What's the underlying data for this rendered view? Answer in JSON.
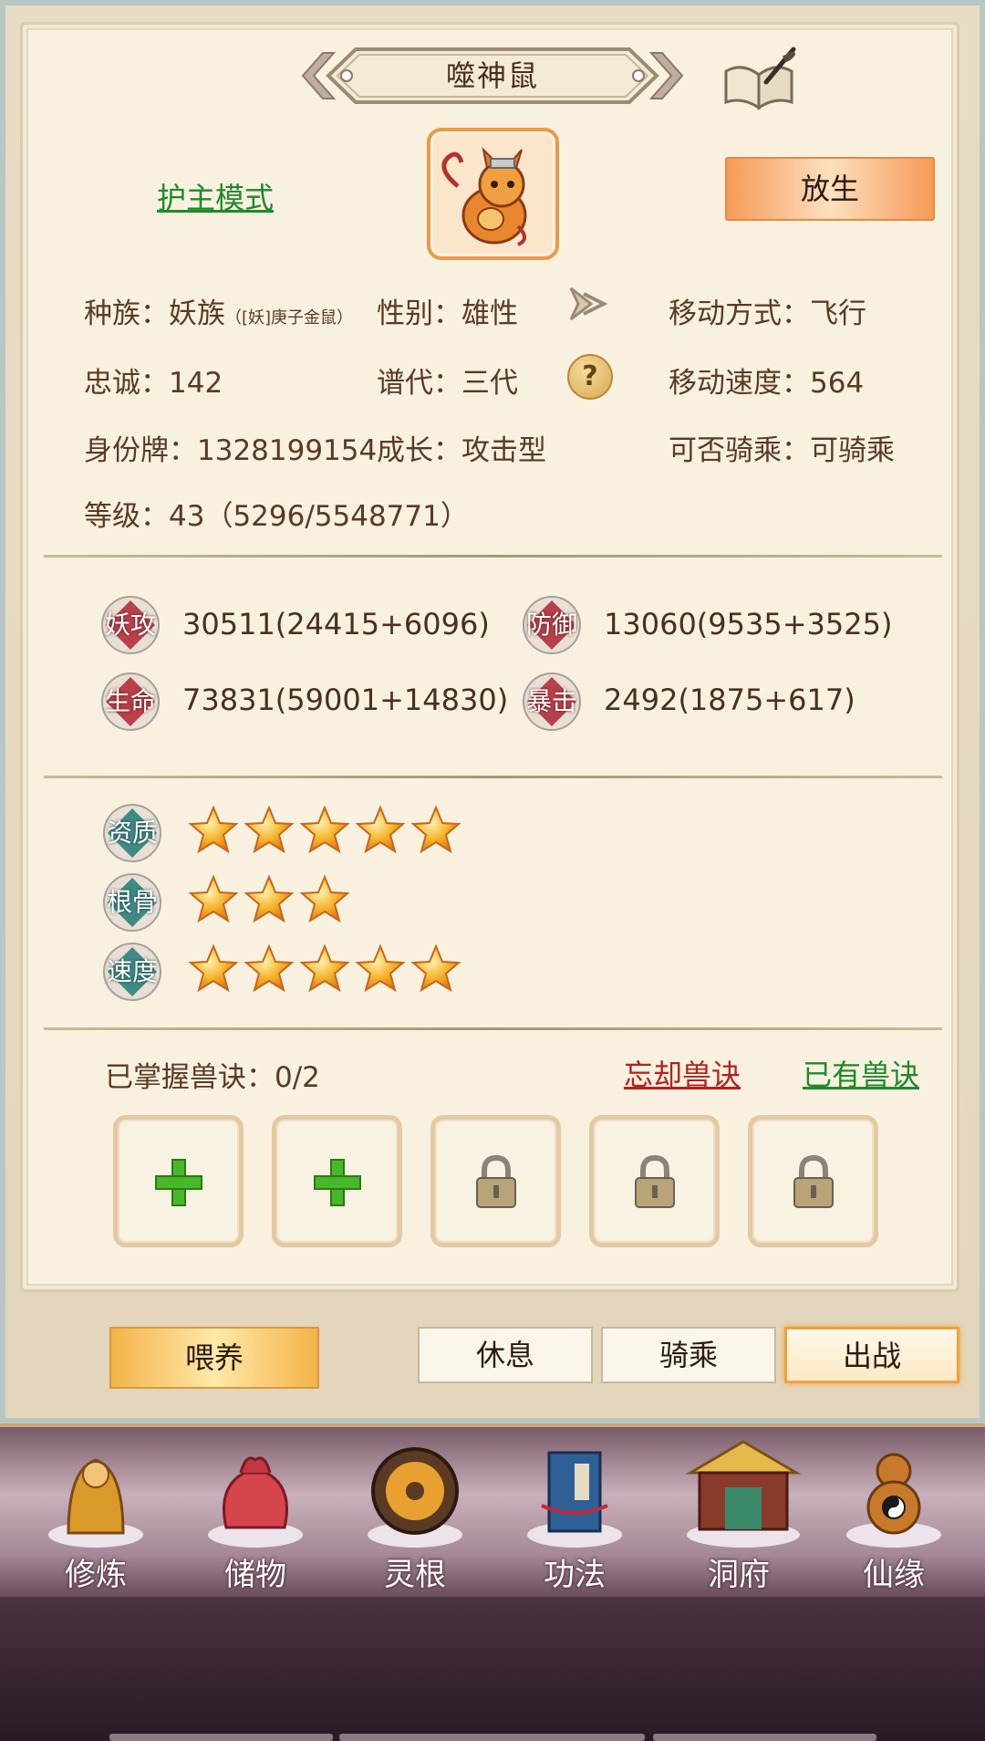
{
  "pet": {
    "name": "噬神鼠",
    "mode_link": "护主模式",
    "release_button": "放生"
  },
  "info": {
    "race": "种族：妖族",
    "race_sub": "（[妖]庚子金鼠）",
    "gender": "性别：雄性",
    "movement_type": "移动方式：飞行",
    "loyalty": "忠诚：142",
    "generation": "谱代：三代",
    "move_speed": "移动速度：564",
    "id_tag": "身份牌：1328199154",
    "growth": "成长：攻击型",
    "rideable": "可否骑乘：可骑乘",
    "level": "等级：43（5296/5548771）"
  },
  "stats": [
    {
      "label": "妖攻",
      "value": "30511(24415+6096)"
    },
    {
      "label": "防御",
      "value": "13060(9535+3525)"
    },
    {
      "label": "生命",
      "value": "73831(59001+14830)"
    },
    {
      "label": "暴击",
      "value": "2492(1875+617)"
    }
  ],
  "attributes": [
    {
      "label": "资质",
      "stars": 5
    },
    {
      "label": "根骨",
      "stars": 3
    },
    {
      "label": "速度",
      "stars": 5
    }
  ],
  "skills": {
    "mastered": "已掌握兽诀：0/2",
    "forget_link": "忘却兽诀",
    "owned_link": "已有兽诀",
    "slots": [
      "add",
      "add",
      "locked",
      "locked",
      "locked"
    ]
  },
  "actions": {
    "feed": "喂养",
    "rest": "休息",
    "ride": "骑乘",
    "battle": "出战",
    "active": "battle"
  },
  "nav": [
    {
      "label": "修炼",
      "icon": "monk-icon"
    },
    {
      "label": "储物",
      "icon": "bag-icon"
    },
    {
      "label": "灵根",
      "icon": "spirit-root-icon"
    },
    {
      "label": "功法",
      "icon": "book-icon"
    },
    {
      "label": "洞府",
      "icon": "palace-icon"
    },
    {
      "label": "仙缘",
      "icon": "gourd-icon"
    }
  ],
  "colors": {
    "link_green": "#1d8a2a",
    "link_red": "#b71f1f",
    "star_gold": "#f6a523",
    "stat_badge": "#b8404a",
    "attr_badge": "#3f8a86"
  }
}
